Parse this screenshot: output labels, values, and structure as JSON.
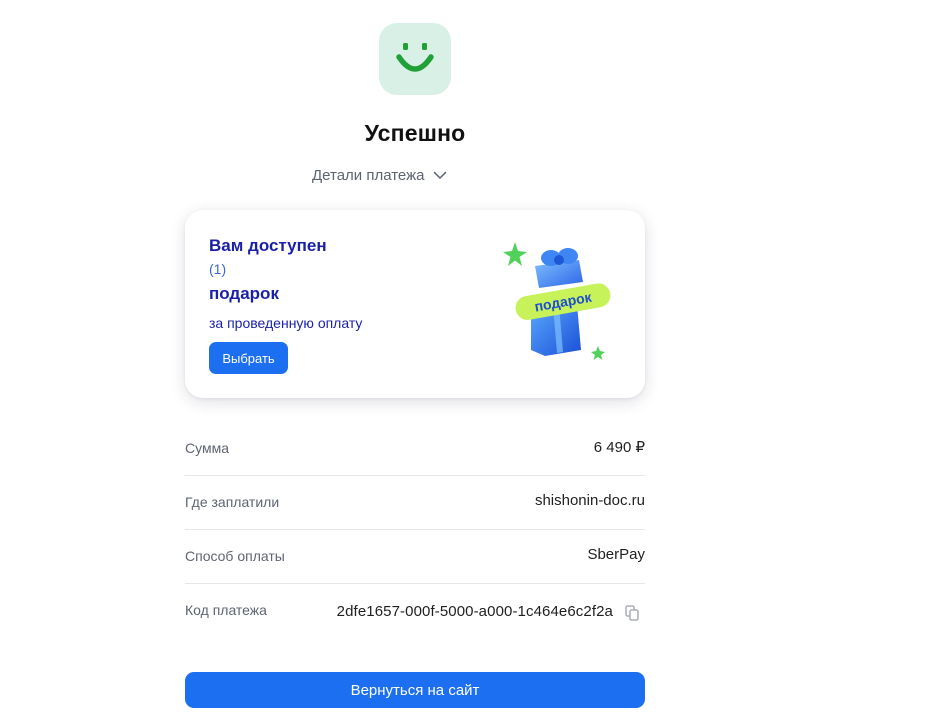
{
  "header": {
    "logo_icon": "smile-icon",
    "title": "Успешно",
    "details_label": "Детали платежа",
    "details_icon": "chevron-down-icon"
  },
  "gift_card": {
    "title_line1": "Вам доступен",
    "count": "(1)",
    "title_line2": "подарок",
    "subtitle": "за проведенную оплату",
    "button_label": "Выбрать",
    "ribbon_text": "подарок"
  },
  "payment_details": [
    {
      "label": "Сумма",
      "value": "6 490 ₽"
    },
    {
      "label": "Где заплатили",
      "value": "shishonin-doc.ru"
    },
    {
      "label": "Способ оплаты",
      "value": "SberPay"
    },
    {
      "label": "Код платежа",
      "value": "2dfe1657-000f-5000-a000-1c464e6c2f2a"
    }
  ],
  "footer": {
    "back_button_label": "Вернуться на сайт"
  },
  "colors": {
    "accent": "#1b6ff0",
    "logo_bg": "#d9f0e6",
    "logo_fg": "#21a038",
    "gift_text": "#1a1fa8"
  }
}
